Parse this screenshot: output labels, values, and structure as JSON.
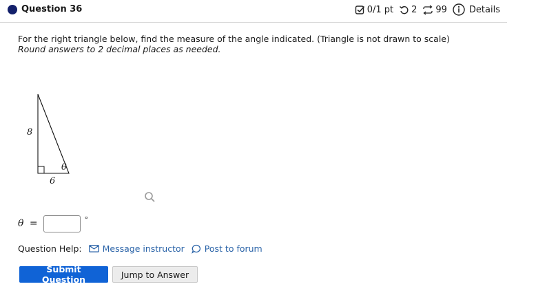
{
  "header": {
    "question_title": "Question 36",
    "score": "0/1 pt",
    "retries": "2",
    "attempts": "99",
    "details_label": "Details",
    "status_color": "#13206b"
  },
  "prompt": {
    "text": "For the right triangle below, find the measure of the angle indicated. (Triangle is not drawn to scale)",
    "hint": "Round answers to 2 decimal places as needed."
  },
  "figure": {
    "side_vertical": "8",
    "side_horizontal": "6",
    "angle_label": "θ"
  },
  "answer": {
    "symbol": "θ",
    "equals": "=",
    "value": "",
    "unit": "°"
  },
  "help": {
    "label": "Question Help:",
    "message_instructor": "Message instructor",
    "post_to_forum": "Post to forum"
  },
  "buttons": {
    "submit": "Submit Question",
    "jump": "Jump to Answer",
    "accent": "#1063d6"
  }
}
